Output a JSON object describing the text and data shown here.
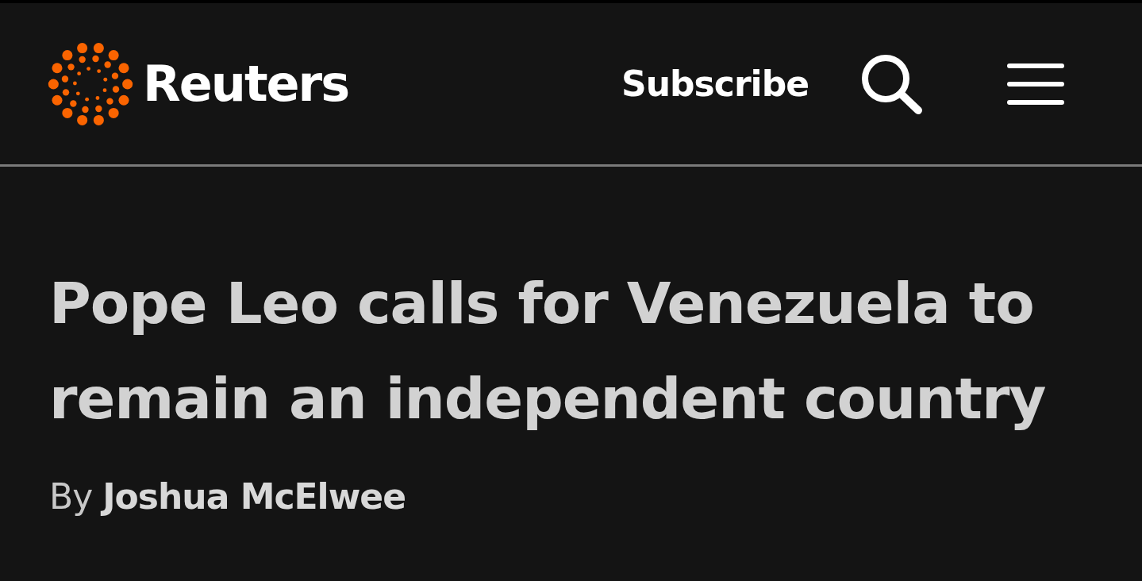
{
  "header": {
    "brand": "Reuters",
    "subscribe": "Subscribe"
  },
  "article": {
    "headline": "Pope Leo calls for Venezuela to remain an independent country",
    "byline": "By **Joshua McElwee**"
  }
}
